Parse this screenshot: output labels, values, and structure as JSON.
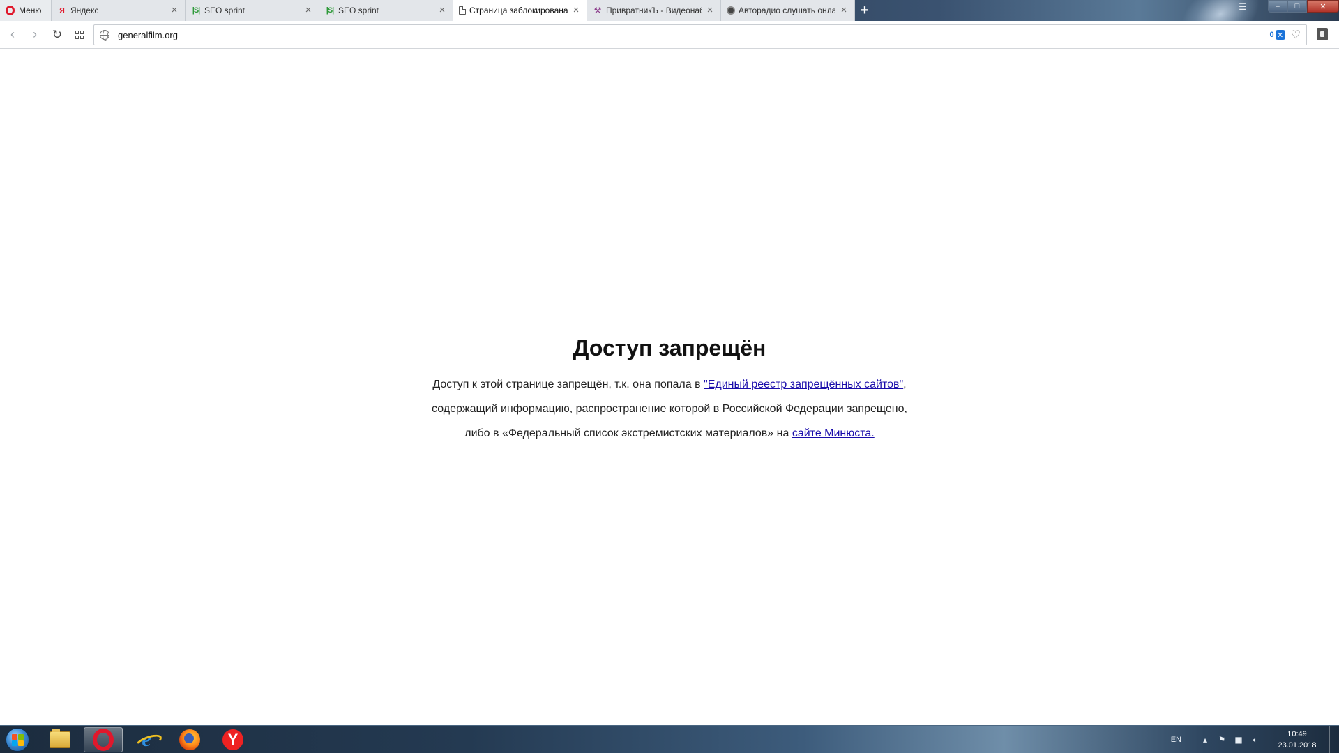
{
  "browser": {
    "menu_label": "Меню",
    "tabs": [
      {
        "title": "Яндекс",
        "favicon": "yandex-icon",
        "active": false
      },
      {
        "title": "SEO sprint",
        "favicon": "seo-sprint-icon",
        "active": false
      },
      {
        "title": "SEO sprint",
        "favicon": "seo-sprint-icon",
        "active": false
      },
      {
        "title": "Страница заблокирована",
        "favicon": "document-icon",
        "active": true
      },
      {
        "title": "ПривратникЪ - Видеонаб",
        "favicon": "tools-icon",
        "active": false
      },
      {
        "title": "Авторадио слушать онла",
        "favicon": "radio-icon",
        "active": false
      }
    ],
    "new_tab_symbol": "+",
    "address": {
      "url": "generalfilm.org",
      "adblock_count": "0"
    }
  },
  "page": {
    "title": "Доступ запрещён",
    "line1_prefix": "Доступ к этой странице запрещён, т.к. она попала в ",
    "line1_link": "\"Единый реестр запрещённых сайтов\"",
    "line1_suffix": ",",
    "line2": "содержащий информацию, распространение которой в Российской Федерации запрещено,",
    "line3_prefix": "либо в «Федеральный список экстремистских материалов» на ",
    "line3_link": "сайте Минюста."
  },
  "taskbar": {
    "apps": [
      "explorer-icon",
      "opera-icon",
      "internet-explorer-icon",
      "firefox-icon",
      "yandex-browser-icon"
    ],
    "lang": "EN",
    "time": "10:49",
    "date": "23.01.2018"
  },
  "colors": {
    "link": "#1a0dab",
    "opera_red": "#e0182c",
    "adblock_blue": "#1a73d9"
  }
}
